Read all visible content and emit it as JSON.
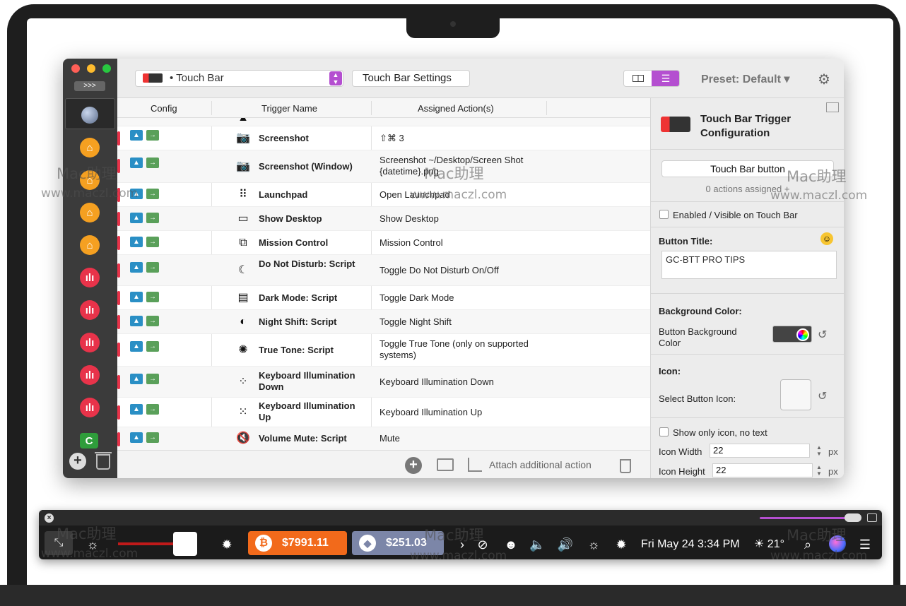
{
  "toolbar": {
    "device_select": "• Touch Bar",
    "settings_button": "Touch Bar Settings",
    "preset_label": "Preset: Default ▾",
    "expand_label": ">>>"
  },
  "table": {
    "headers": [
      "Config",
      "Trigger Name",
      "Assigned Action(s)"
    ],
    "rows": [
      {
        "icon": "screenshot-icon",
        "name": "Screenshot",
        "action": "⇧⌘ 3"
      },
      {
        "icon": "screenshot-window-icon",
        "name": "Screenshot (Window)",
        "action": "Screenshot ~/Desktop/Screen Shot {datetime}.png"
      },
      {
        "icon": "launchpad-icon",
        "name": "Launchpad",
        "action": "Open Launchpad"
      },
      {
        "icon": "desktop-icon",
        "name": "Show Desktop",
        "action": "Show Desktop"
      },
      {
        "icon": "mission-control-icon",
        "name": "Mission Control",
        "action": "Mission Control"
      },
      {
        "icon": "moon-icon",
        "name": "Do Not Disturb: Script",
        "action": "Toggle Do Not Disturb On/Off"
      },
      {
        "icon": "dark-mode-icon",
        "name": "Dark Mode: Script",
        "action": "Toggle Dark Mode"
      },
      {
        "icon": "night-shift-icon",
        "name": "Night Shift: Script",
        "action": "Toggle Night Shift"
      },
      {
        "icon": "true-tone-icon",
        "name": "True Tone: Script",
        "action": "Toggle True Tone (only on supported systems)"
      },
      {
        "icon": "keyboard-light-down-icon",
        "name": "Keyboard Illumination Down",
        "action": "Keyboard Illumination Down"
      },
      {
        "icon": "keyboard-light-up-icon",
        "name": "Keyboard Illumination Up",
        "action": "Keyboard Illumination Up"
      },
      {
        "icon": "mute-icon",
        "name": "Volume Mute: Script",
        "action": "Mute"
      }
    ],
    "footer_attach": "Attach additional action"
  },
  "config": {
    "title": "Touch Bar Trigger Configuration",
    "type_select": "Touch Bar button",
    "actions_assigned": "0 actions assigned +",
    "enabled_label": "Enabled / Visible on Touch Bar",
    "button_title_label": "Button Title:",
    "button_title_value": "GC-BTT PRO TIPS",
    "bg_color_heading": "Background Color:",
    "bg_color_label": "Button Background Color",
    "icon_heading": "Icon:",
    "select_icon_label": "Select Button Icon:",
    "only_icon_label": "Show only icon, no text",
    "icon_width_label": "Icon Width",
    "icon_width_value": "22",
    "icon_height_label": "Icon Height",
    "icon_height_value": "22",
    "unit": "px"
  },
  "touchbar": {
    "btc_price": "$7991.11",
    "eth_price": "$251.03",
    "clock": "Fri May 24 3:34 PM",
    "weather": "☀ 21°"
  },
  "watermark": {
    "brand": "Mac助理",
    "url": "www.maczl.com"
  },
  "colors": {
    "accent": "#b44fd0",
    "bitcoin": "#f26a1b",
    "ethereum": "#7c86a8",
    "stripe_red": "#e8334a"
  }
}
